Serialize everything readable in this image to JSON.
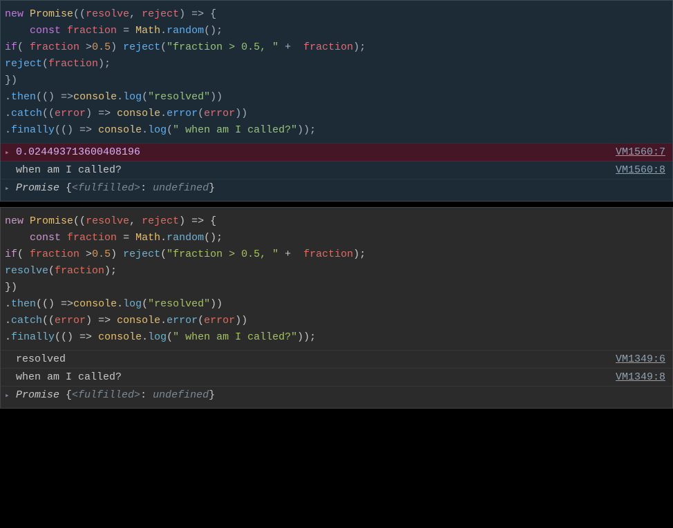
{
  "panel1": {
    "code": {
      "l1": {
        "kw_new": "new",
        "cls": "Promise",
        "po": "((",
        "v1": "resolve",
        "cm": ", ",
        "v2": "reject",
        "pc": ") ",
        "arrow": "=>",
        "brace": " {"
      },
      "l2": {
        "pad": "    ",
        "kw_const": "const",
        "sp": " ",
        "var": "fraction",
        "eq": " = ",
        "cls": "Math",
        "dot": ".",
        "fn": "random",
        "call": "();"
      },
      "l3": {
        "kw_if": "if",
        "po": "( ",
        "var": "fraction",
        "op": " >",
        "num": "0.5",
        "pc": ") ",
        "fn": "reject",
        "po2": "(",
        "str": "\"fraction > 0.5, \"",
        "plus": " + ",
        "var2": " fraction",
        "pc2": ");"
      },
      "l4": {
        "fn": "reject",
        "po": "(",
        "var": "fraction",
        "pc": ");"
      },
      "l5": {
        "txt": "})"
      },
      "l6": {
        "dot": ".",
        "fn": "then",
        "po": "(() ",
        "arrow": "=>",
        "cls": "console",
        "dot2": ".",
        "fn2": "log",
        "po2": "(",
        "str": "\"resolved\"",
        "pc": "))"
      },
      "l7": {
        "dot": ".",
        "fn": "catch",
        "po": "((",
        "var": "error",
        "pc": ") ",
        "arrow": "=>",
        "sp": " ",
        "cls": "console",
        "dot2": ".",
        "fn2": "error",
        "po2": "(",
        "var2": "error",
        "pc2": "))"
      },
      "l8": {
        "dot": ".",
        "fn": "finally",
        "po": "(() ",
        "arrow": "=>",
        "sp": " ",
        "cls": "console",
        "dot2": ".",
        "fn2": "log",
        "po2": "(",
        "str": "\" when am I called?\"",
        "pc": "));"
      }
    },
    "out_error": {
      "value": "0.024493713600408196",
      "source": "VM1560:7"
    },
    "out_log": {
      "value": " when am I called?",
      "source": "VM1560:8"
    },
    "out_result": {
      "name": "Promise",
      "state": "<fulfilled>",
      "value": "undefined"
    }
  },
  "panel2": {
    "code": {
      "l1": {
        "kw_new": "new",
        "cls": "Promise",
        "po": "((",
        "v1": "resolve",
        "cm": ", ",
        "v2": "reject",
        "pc": ") ",
        "arrow": "=>",
        "brace": " {"
      },
      "l2": {
        "pad": "    ",
        "kw_const": "const",
        "sp": " ",
        "var": "fraction",
        "eq": " = ",
        "cls": "Math",
        "dot": ".",
        "fn": "random",
        "call": "();"
      },
      "l3": {
        "kw_if": "if",
        "po": "( ",
        "var": "fraction",
        "op": " >",
        "num": "0.5",
        "pc": ") ",
        "fn": "reject",
        "po2": "(",
        "str": "\"fraction > 0.5, \"",
        "plus": " + ",
        "var2": " fraction",
        "pc2": ");"
      },
      "l4": {
        "fn": "resolve",
        "po": "(",
        "var": "fraction",
        "pc": ");"
      },
      "l5": {
        "txt": "})"
      },
      "l6": {
        "dot": ".",
        "fn": "then",
        "po": "(() ",
        "arrow": "=>",
        "cls": "console",
        "dot2": ".",
        "fn2": "log",
        "po2": "(",
        "str": "\"resolved\"",
        "pc": "))"
      },
      "l7": {
        "dot": ".",
        "fn": "catch",
        "po": "((",
        "var": "error",
        "pc": ") ",
        "arrow": "=>",
        "sp": " ",
        "cls": "console",
        "dot2": ".",
        "fn2": "error",
        "po2": "(",
        "var2": "error",
        "pc2": "))"
      },
      "l8": {
        "dot": ".",
        "fn": "finally",
        "po": "(() ",
        "arrow": "=>",
        "sp": " ",
        "cls": "console",
        "dot2": ".",
        "fn2": "log",
        "po2": "(",
        "str": "\" when am I called?\"",
        "pc": "));"
      }
    },
    "out_log1": {
      "value": "resolved",
      "source": "VM1349:6"
    },
    "out_log2": {
      "value": " when am I called?",
      "source": "VM1349:8"
    },
    "out_result": {
      "name": "Promise",
      "state": "<fulfilled>",
      "value": "undefined"
    }
  }
}
